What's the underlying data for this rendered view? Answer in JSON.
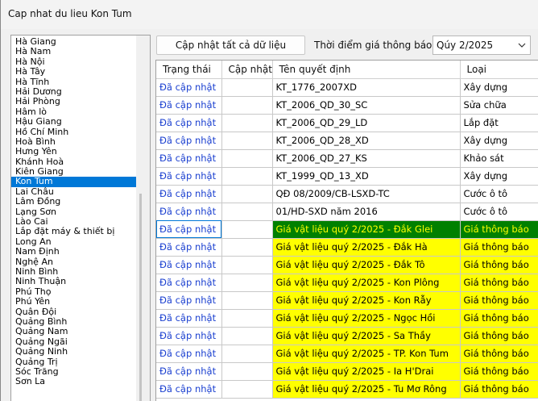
{
  "window": {
    "title": "Cap nhat du lieu Kon Tum"
  },
  "provinces": [
    "Hà Giang",
    "Hà Nam",
    "Hà Nội",
    "Hà Tây",
    "Hà Tĩnh",
    "Hải Dương",
    "Hải Phòng",
    "Hâm lò",
    "Hậu Giang",
    "Hồ Chí Minh",
    "Hoà Bình",
    "Hưng Yên",
    "Khánh Hoà",
    "Kiên Giang",
    "Kon Tum",
    "Lai Châu",
    "Lâm Đồng",
    "Lạng Sơn",
    "Lào Cai",
    "Lắp đặt máy & thiết bị",
    "Long An",
    "Nam Định",
    "Nghệ An",
    "Ninh Bình",
    "Ninh Thuận",
    "Phú Thọ",
    "Phú Yên",
    "Quân Đội",
    "Quảng Bình",
    "Quảng Nam",
    "Quảng Ngãi",
    "Quảng Ninh",
    "Quảng Trị",
    "Sóc Trăng",
    "Sơn La"
  ],
  "selected_province": "Kon Tum",
  "toolbar": {
    "update_all_label": "Cập nhật tất cả dữ liệu",
    "time_label": "Thời điểm giá thông báo",
    "period_value": "Qúy 2/2025"
  },
  "table": {
    "headers": {
      "status": "Trạng thái",
      "update": "Cập nhật",
      "name": "Tên quyết định",
      "type": "Loại"
    },
    "rows": [
      {
        "status": "Đã cập nhật",
        "name": "KT_1776_2007XD",
        "type": "Xây dựng",
        "style": "normal"
      },
      {
        "status": "Đã cập nhật",
        "name": "KT_2006_QD_30_SC",
        "type": "Sửa chữa",
        "style": "normal"
      },
      {
        "status": "Đã cập nhật",
        "name": "KT_2006_QD_29_LD",
        "type": "Lắp đặt",
        "style": "normal"
      },
      {
        "status": "Đã cập nhật",
        "name": "KT_2006_QD_28_XD",
        "type": "Xây dựng",
        "style": "normal"
      },
      {
        "status": "Đã cập nhật",
        "name": "KT_2006_QD_27_KS",
        "type": "Khảo sát",
        "style": "normal"
      },
      {
        "status": "Đã cập nhật",
        "name": "KT_1999_QD_13_XD",
        "type": "Xây dựng",
        "style": "normal"
      },
      {
        "status": "Đã cập nhật",
        "name": "QĐ 08/2009/CB-LSXD-TC",
        "type": "Cước ô tô",
        "style": "normal"
      },
      {
        "status": "Đã cập nhật",
        "name": "01/HD-SXD năm 2016",
        "type": "Cước ô tô",
        "style": "normal"
      },
      {
        "status": "Đã cập nhật",
        "name": "Giá vật liệu quý 2/2025 - Đắk Glei",
        "type": "Giá thông báo",
        "style": "green"
      },
      {
        "status": "Đã cập nhật",
        "name": "Giá vật liệu quý 2/2025 - Đắk Hà",
        "type": "Giá thông báo",
        "style": "yellow"
      },
      {
        "status": "Đã cập nhật",
        "name": "Giá vật liệu quý 2/2025 - Đắk Tô",
        "type": "Giá thông báo",
        "style": "yellow"
      },
      {
        "status": "Đã cập nhật",
        "name": "Giá vật liệu quý 2/2025 - Kon Plông",
        "type": "Giá thông báo",
        "style": "yellow"
      },
      {
        "status": "Đã cập nhật",
        "name": "Giá vật liệu quý 2/2025 - Kon Rẫy",
        "type": "Giá thông báo",
        "style": "yellow"
      },
      {
        "status": "Đã cập nhật",
        "name": "Giá vật liệu quý 2/2025 - Ngọc Hồi",
        "type": "Giá thông báo",
        "style": "yellow"
      },
      {
        "status": "Đã cập nhật",
        "name": "Giá vật liệu quý 2/2025 - Sa Thầy",
        "type": "Giá thông báo",
        "style": "yellow"
      },
      {
        "status": "Đã cập nhật",
        "name": "Giá vật liệu quý 2/2025 - TP. Kon Tum",
        "type": "Giá thông báo",
        "style": "yellow"
      },
      {
        "status": "Đã cập nhật",
        "name": "Giá vật liệu quý 2/2025 - Ia H'Drai",
        "type": "Giá thông báo",
        "style": "yellow"
      },
      {
        "status": "Đã cập nhật",
        "name": "Giá vật liệu quý 2/2025 - Tu Mơ Rông",
        "type": "Giá thông báo",
        "style": "yellow"
      }
    ]
  },
  "colors": {
    "status_text": "#1a3fd0",
    "highlight_yellow": "#ffff00",
    "highlight_green": "#008000",
    "selection": "#0078d7"
  }
}
